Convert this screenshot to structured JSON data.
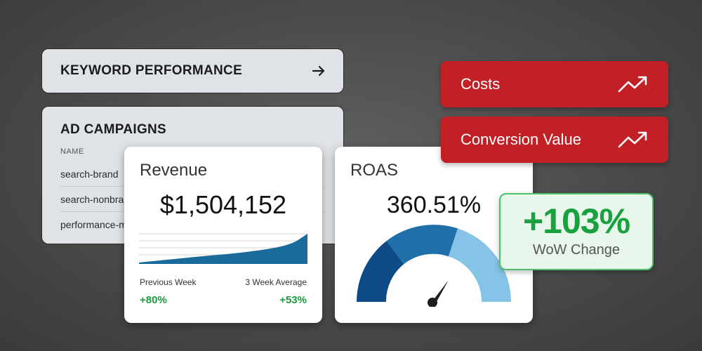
{
  "keyword_performance": {
    "title": "KEYWORD PERFORMANCE"
  },
  "ad_campaigns": {
    "title": "AD CAMPAIGNS",
    "column_header": "NAME",
    "rows": [
      "search-brand",
      "search-nonbrand",
      "performance-max"
    ]
  },
  "revenue": {
    "title": "Revenue",
    "value": "$1,504,152",
    "previous_week_label": "Previous Week",
    "previous_week_value": "+80%",
    "three_week_label": "3 Week Average",
    "three_week_value": "+53%"
  },
  "roas": {
    "title": "ROAS",
    "value": "360.51%"
  },
  "pills": [
    {
      "label": "Costs"
    },
    {
      "label": "Conversion Value"
    }
  ],
  "wow": {
    "value": "+103%",
    "label": "WoW Change"
  },
  "colors": {
    "red": "#c21f26",
    "green": "#19a03f",
    "gauge_dark": "#0d4a86",
    "gauge_mid": "#1f6fa8",
    "gauge_light": "#85c4e6",
    "area_fill": "#1a6a9a"
  },
  "icons": [
    "arrow-right-icon",
    "trend-up-icon",
    "gauge-needle-icon"
  ]
}
